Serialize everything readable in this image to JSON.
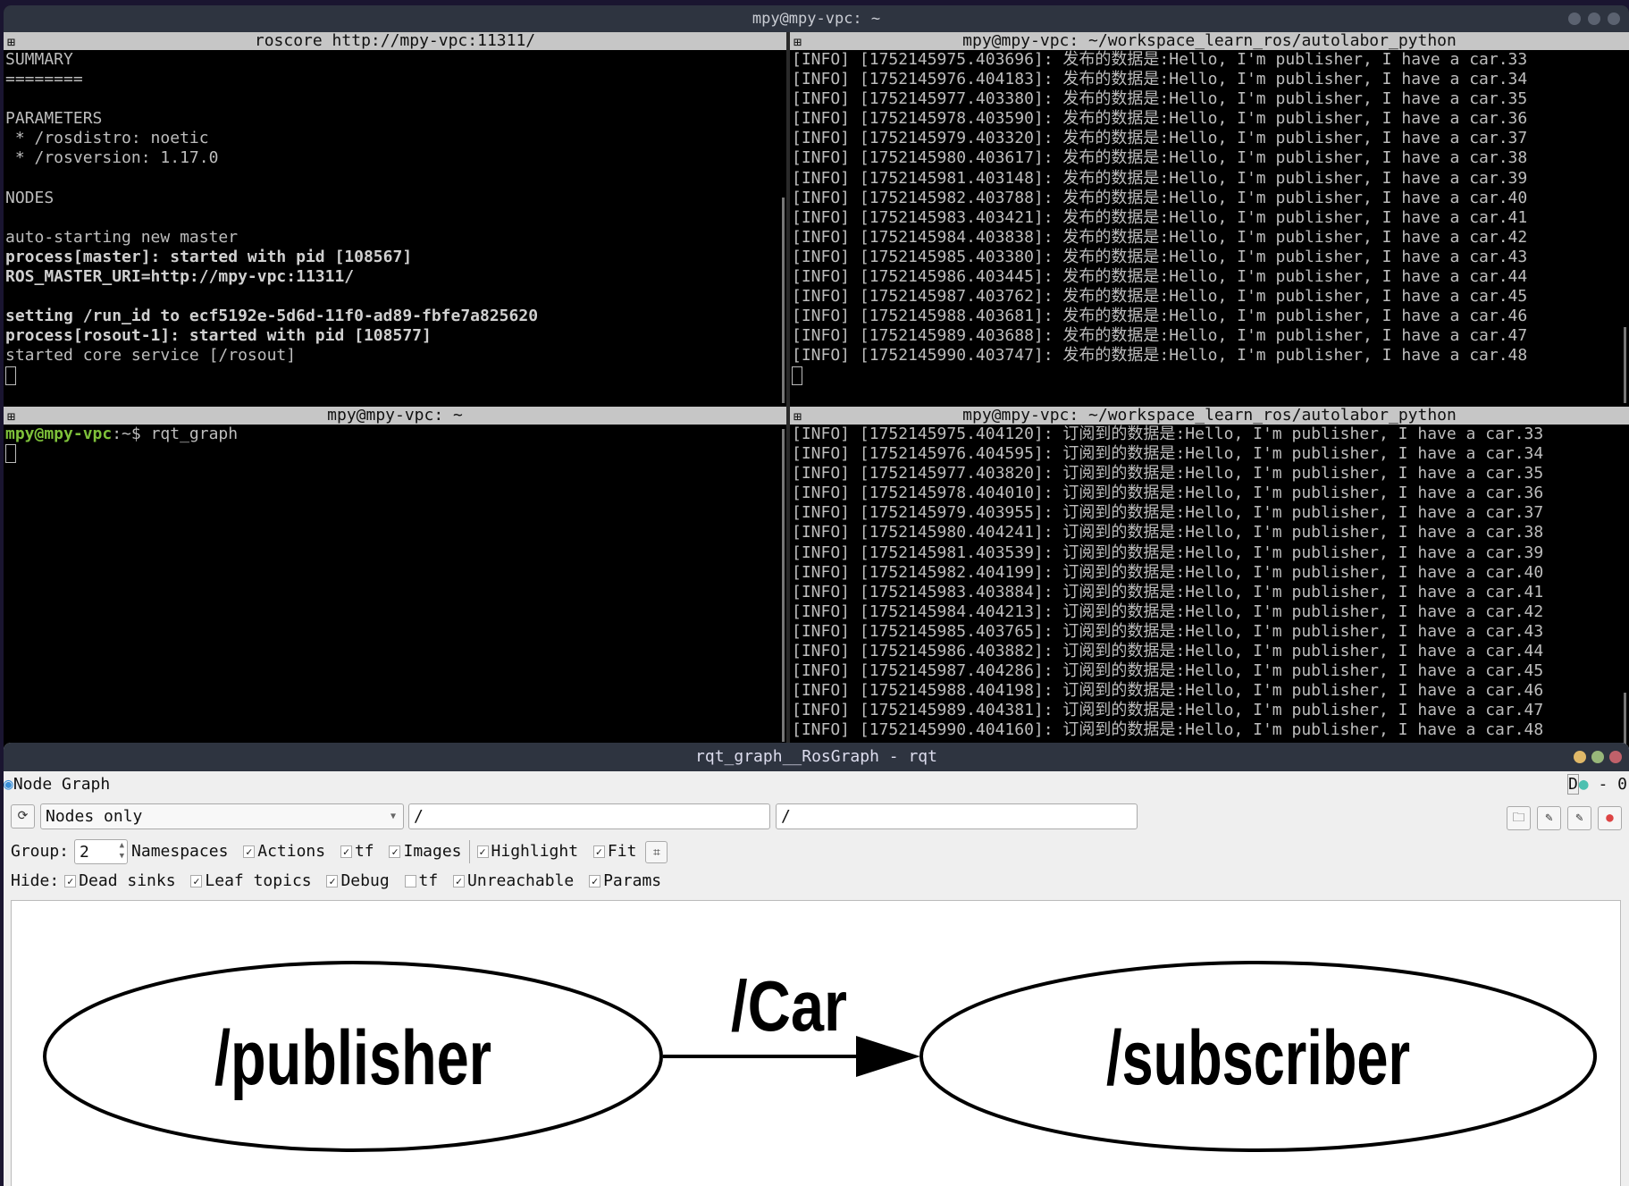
{
  "main_window": {
    "title": "mpy@mpy-vpc: ~"
  },
  "pane_roscore": {
    "title": "roscore http://mpy-vpc:11311/",
    "lines": [
      {
        "t": "SUMMARY",
        "b": false
      },
      {
        "t": "========",
        "b": false
      },
      {
        "t": "",
        "b": false
      },
      {
        "t": "PARAMETERS",
        "b": false
      },
      {
        "t": " * /rosdistro: noetic",
        "b": false
      },
      {
        "t": " * /rosversion: 1.17.0",
        "b": false
      },
      {
        "t": "",
        "b": false
      },
      {
        "t": "NODES",
        "b": false
      },
      {
        "t": "",
        "b": false
      },
      {
        "t": "auto-starting new master",
        "b": false
      },
      {
        "t": "process[master]: started with pid [108567]",
        "b": true
      },
      {
        "t": "ROS_MASTER_URI=http://mpy-vpc:11311/",
        "b": true
      },
      {
        "t": "",
        "b": false
      },
      {
        "t": "setting /run_id to ecf5192e-5d6d-11f0-ad89-fbfe7a825620",
        "b": true
      },
      {
        "t": "process[rosout-1]: started with pid [108577]",
        "b": true
      },
      {
        "t": "started core service [/rosout]",
        "b": false
      }
    ]
  },
  "pane_publisher": {
    "title": "mpy@mpy-vpc: ~/workspace_learn_ros/autolabor_python",
    "lines": [
      "[INFO] [1752145975.403696]: 发布的数据是:Hello, I'm publisher, I have a car.33",
      "[INFO] [1752145976.404183]: 发布的数据是:Hello, I'm publisher, I have a car.34",
      "[INFO] [1752145977.403380]: 发布的数据是:Hello, I'm publisher, I have a car.35",
      "[INFO] [1752145978.403590]: 发布的数据是:Hello, I'm publisher, I have a car.36",
      "[INFO] [1752145979.403320]: 发布的数据是:Hello, I'm publisher, I have a car.37",
      "[INFO] [1752145980.403617]: 发布的数据是:Hello, I'm publisher, I have a car.38",
      "[INFO] [1752145981.403148]: 发布的数据是:Hello, I'm publisher, I have a car.39",
      "[INFO] [1752145982.403788]: 发布的数据是:Hello, I'm publisher, I have a car.40",
      "[INFO] [1752145983.403421]: 发布的数据是:Hello, I'm publisher, I have a car.41",
      "[INFO] [1752145984.403838]: 发布的数据是:Hello, I'm publisher, I have a car.42",
      "[INFO] [1752145985.403380]: 发布的数据是:Hello, I'm publisher, I have a car.43",
      "[INFO] [1752145986.403445]: 发布的数据是:Hello, I'm publisher, I have a car.44",
      "[INFO] [1752145987.403762]: 发布的数据是:Hello, I'm publisher, I have a car.45",
      "[INFO] [1752145988.403681]: 发布的数据是:Hello, I'm publisher, I have a car.46",
      "[INFO] [1752145989.403688]: 发布的数据是:Hello, I'm publisher, I have a car.47",
      "[INFO] [1752145990.403747]: 发布的数据是:Hello, I'm publisher, I have a car.48"
    ]
  },
  "pane_shell": {
    "title": "mpy@mpy-vpc: ~",
    "prompt_user": "mpy@mpy-vpc",
    "prompt_rest": ":~$ ",
    "command": "rqt_graph"
  },
  "pane_subscriber": {
    "title": "mpy@mpy-vpc: ~/workspace_learn_ros/autolabor_python",
    "lines": [
      "[INFO] [1752145975.404120]: 订阅到的数据是:Hello, I'm publisher, I have a car.33",
      "[INFO] [1752145976.404595]: 订阅到的数据是:Hello, I'm publisher, I have a car.34",
      "[INFO] [1752145977.403820]: 订阅到的数据是:Hello, I'm publisher, I have a car.35",
      "[INFO] [1752145978.404010]: 订阅到的数据是:Hello, I'm publisher, I have a car.36",
      "[INFO] [1752145979.403955]: 订阅到的数据是:Hello, I'm publisher, I have a car.37",
      "[INFO] [1752145980.404241]: 订阅到的数据是:Hello, I'm publisher, I have a car.38",
      "[INFO] [1752145981.403539]: 订阅到的数据是:Hello, I'm publisher, I have a car.39",
      "[INFO] [1752145982.404199]: 订阅到的数据是:Hello, I'm publisher, I have a car.40",
      "[INFO] [1752145983.403884]: 订阅到的数据是:Hello, I'm publisher, I have a car.41",
      "[INFO] [1752145984.404213]: 订阅到的数据是:Hello, I'm publisher, I have a car.42",
      "[INFO] [1752145985.403765]: 订阅到的数据是:Hello, I'm publisher, I have a car.43",
      "[INFO] [1752145986.403882]: 订阅到的数据是:Hello, I'm publisher, I have a car.44",
      "[INFO] [1752145987.404286]: 订阅到的数据是:Hello, I'm publisher, I have a car.45",
      "[INFO] [1752145988.404198]: 订阅到的数据是:Hello, I'm publisher, I have a car.46",
      "[INFO] [1752145989.404381]: 订阅到的数据是:Hello, I'm publisher, I have a car.47",
      "[INFO] [1752145990.404160]: 订阅到的数据是:Hello, I'm publisher, I have a car.48"
    ]
  },
  "rqt": {
    "title": "rqt_graph__RosGraph - rqt",
    "plugin_title": "Node Graph",
    "plugin_ctrl": "- 0",
    "plugin_d": "D",
    "mode": "Nodes only",
    "ns_filter": "/",
    "topic_filter": "/",
    "group_label": "Group:",
    "group_value": "2",
    "opts": [
      {
        "label": "Namespaces"
      },
      {
        "label": "Actions",
        "checked": true
      },
      {
        "label": "tf",
        "checked": true
      },
      {
        "label": "Images",
        "checked": true
      }
    ],
    "opts2": [
      {
        "label": "Highlight",
        "checked": true
      },
      {
        "label": "Fit",
        "checked": true
      }
    ],
    "hide_label": "Hide:",
    "hide": [
      {
        "label": "Dead sinks",
        "checked": true
      },
      {
        "label": "Leaf topics",
        "checked": true
      },
      {
        "label": "Debug",
        "checked": true
      },
      {
        "label": "tf",
        "checked": false
      },
      {
        "label": "Unreachable",
        "checked": true
      },
      {
        "label": "Params",
        "checked": true
      }
    ],
    "graph": {
      "source": "/publisher",
      "topic": "/Car",
      "target": "/subscriber"
    },
    "colors": {
      "close": "#c0616a",
      "max": "#98b77a",
      "min": "#e0b868"
    }
  }
}
